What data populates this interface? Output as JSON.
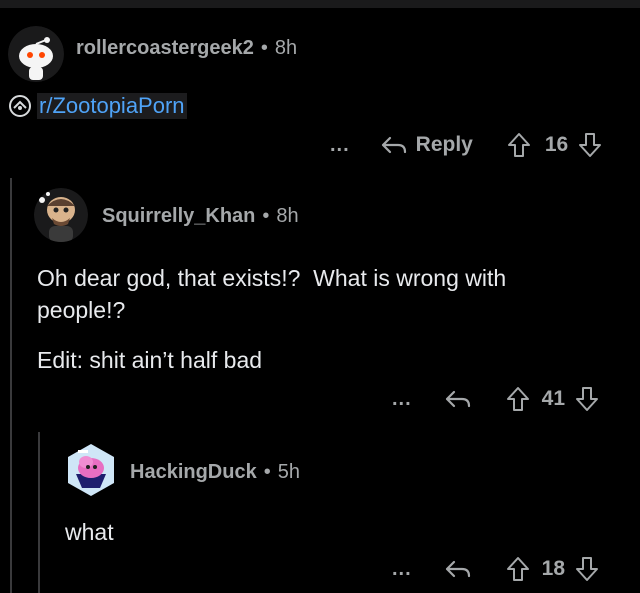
{
  "comments": [
    {
      "username": "rollercoastergeek2",
      "separator": "•",
      "time": "8h",
      "subreddit_link": "r/ZootopiaPorn",
      "actions": {
        "more": "...",
        "reply": "Reply",
        "votes": "16"
      }
    },
    {
      "username": "Squirrelly_Khan",
      "separator": "•",
      "time": "8h",
      "body_line1": "Oh dear god, that exists!?  What is wrong with",
      "body_line2": "people!?",
      "body_line3": "Edit: shit ain’t half bad",
      "actions": {
        "more": "...",
        "votes": "41"
      }
    },
    {
      "username": "HackingDuck",
      "separator": "•",
      "time": "5h",
      "body_line1": "what",
      "actions": {
        "more": "...",
        "votes": "18"
      }
    }
  ],
  "colors": {
    "background": "#000000",
    "link": "#4fa3f7",
    "muted": "#a5a8aa",
    "text": "#e8eaed"
  }
}
